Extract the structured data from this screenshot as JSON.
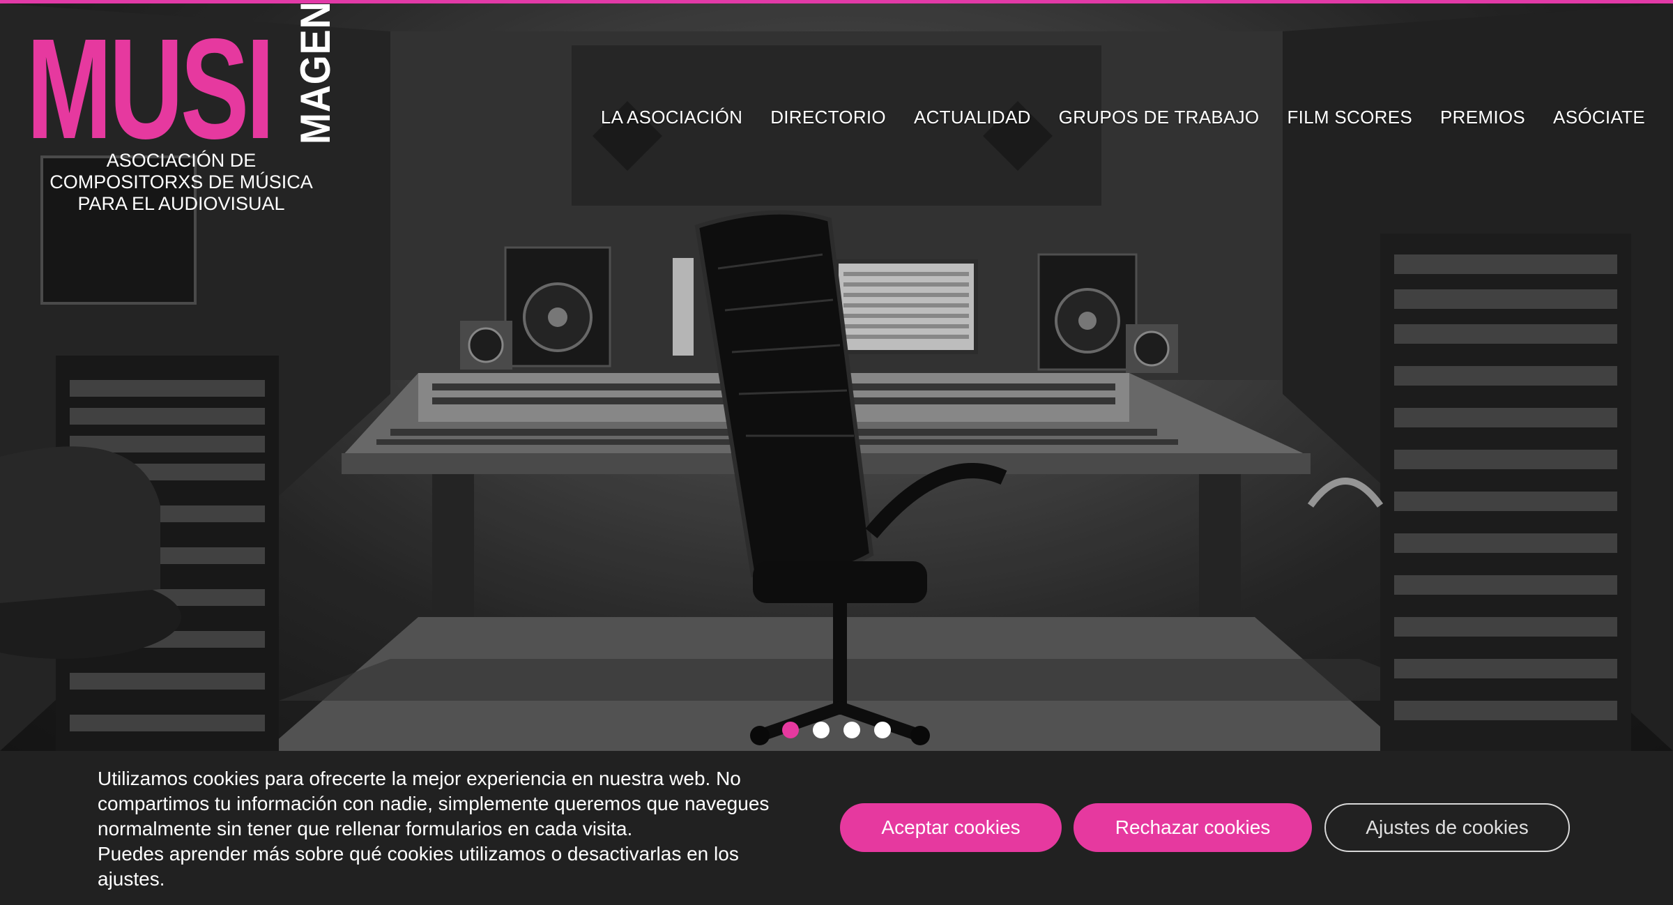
{
  "brand": {
    "logo_main": "MUSI",
    "logo_vertical": "MAGEN",
    "tagline_lines": [
      "ASOCIACIÓN DE",
      "COMPOSITORXS DE MÚSICA",
      "PARA EL AUDIOVISUAL"
    ],
    "accent_color": "#e6399f"
  },
  "nav": {
    "items": [
      {
        "label": "LA ASOCIACIÓN"
      },
      {
        "label": "DIRECTORIO"
      },
      {
        "label": "ACTUALIDAD"
      },
      {
        "label": "GRUPOS DE TRABAJO"
      },
      {
        "label": "FILM SCORES"
      },
      {
        "label": "PREMIOS"
      },
      {
        "label": "ASÓCIATE"
      }
    ]
  },
  "hero": {
    "image": "recording-studio-photo",
    "slides_total": 4,
    "active_slide": 1
  },
  "cookie_banner": {
    "text_1": "Utilizamos cookies para ofrecerte la mejor experiencia en nuestra web. No compartimos tu información con nadie, simplemente queremos que navegues normalmente sin tener que rellenar formularios en cada visita.",
    "text_2": "Puedes aprender más sobre qué cookies utilizamos o desactivarlas en los ajustes.",
    "accept_label": "Aceptar cookies",
    "reject_label": "Rechazar cookies",
    "settings_label": "Ajustes de cookies"
  }
}
